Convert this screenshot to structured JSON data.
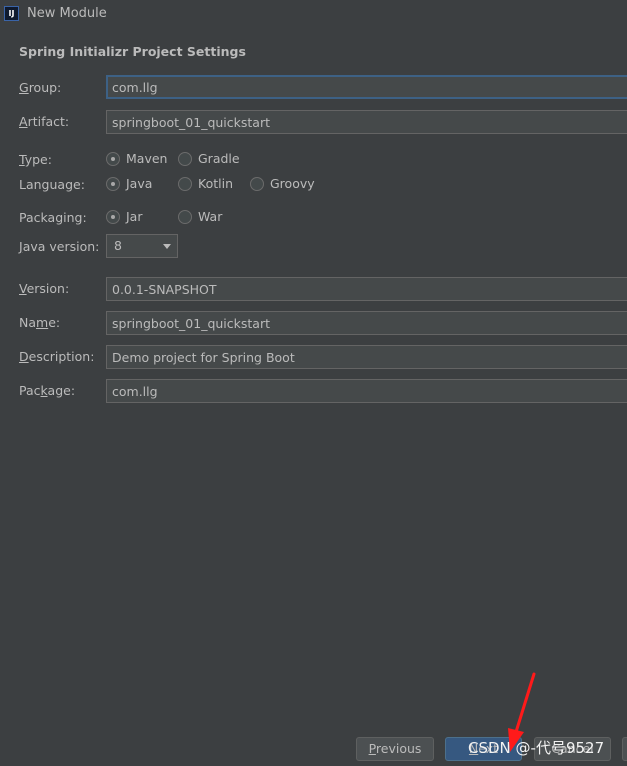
{
  "window": {
    "icon_text": "IJ",
    "title": "New Module"
  },
  "section_title": "Spring Initializr Project Settings",
  "fields": {
    "group": {
      "mn": "G",
      "rest": "roup:",
      "value": "com.llg"
    },
    "artifact": {
      "mn": "A",
      "rest": "rtifact:",
      "value": "springboot_01_quickstart"
    },
    "version": {
      "mn": "V",
      "rest": "ersion:",
      "value": "0.0.1-SNAPSHOT"
    },
    "name": {
      "pre": "Na",
      "mn": "m",
      "rest": "e:",
      "value": "springboot_01_quickstart"
    },
    "description": {
      "mn": "D",
      "rest": "escription:",
      "value": "Demo project for Spring Boot"
    },
    "package": {
      "pre": "Pac",
      "mn": "k",
      "rest": "age:",
      "value": "com.llg"
    }
  },
  "type": {
    "mn": "T",
    "rest": "ype:",
    "options": [
      "Maven",
      "Gradle"
    ],
    "selected": "Maven"
  },
  "language": {
    "label": "Language:",
    "options": [
      "Java",
      "Kotlin",
      "Groovy"
    ],
    "selected": "Java"
  },
  "packaging": {
    "label": "Packaging:",
    "options": [
      "Jar",
      "War"
    ],
    "selected": "Jar"
  },
  "java_version": {
    "mn": "J",
    "rest": "ava version:",
    "value": "8"
  },
  "buttons": {
    "previous": {
      "mn": "P",
      "rest": "revious"
    },
    "next": {
      "mn": "N",
      "rest": "ext"
    },
    "cancel": {
      "label": "Cancel"
    }
  },
  "watermark": "CSDN @-代号9527",
  "colors": {
    "background": "#3c3f41",
    "text": "#bbbbbb",
    "field_bg": "#45494a",
    "focus_border": "#3d6185",
    "primary_button": "#365880",
    "annotation_arrow": "#ff1a1a"
  }
}
